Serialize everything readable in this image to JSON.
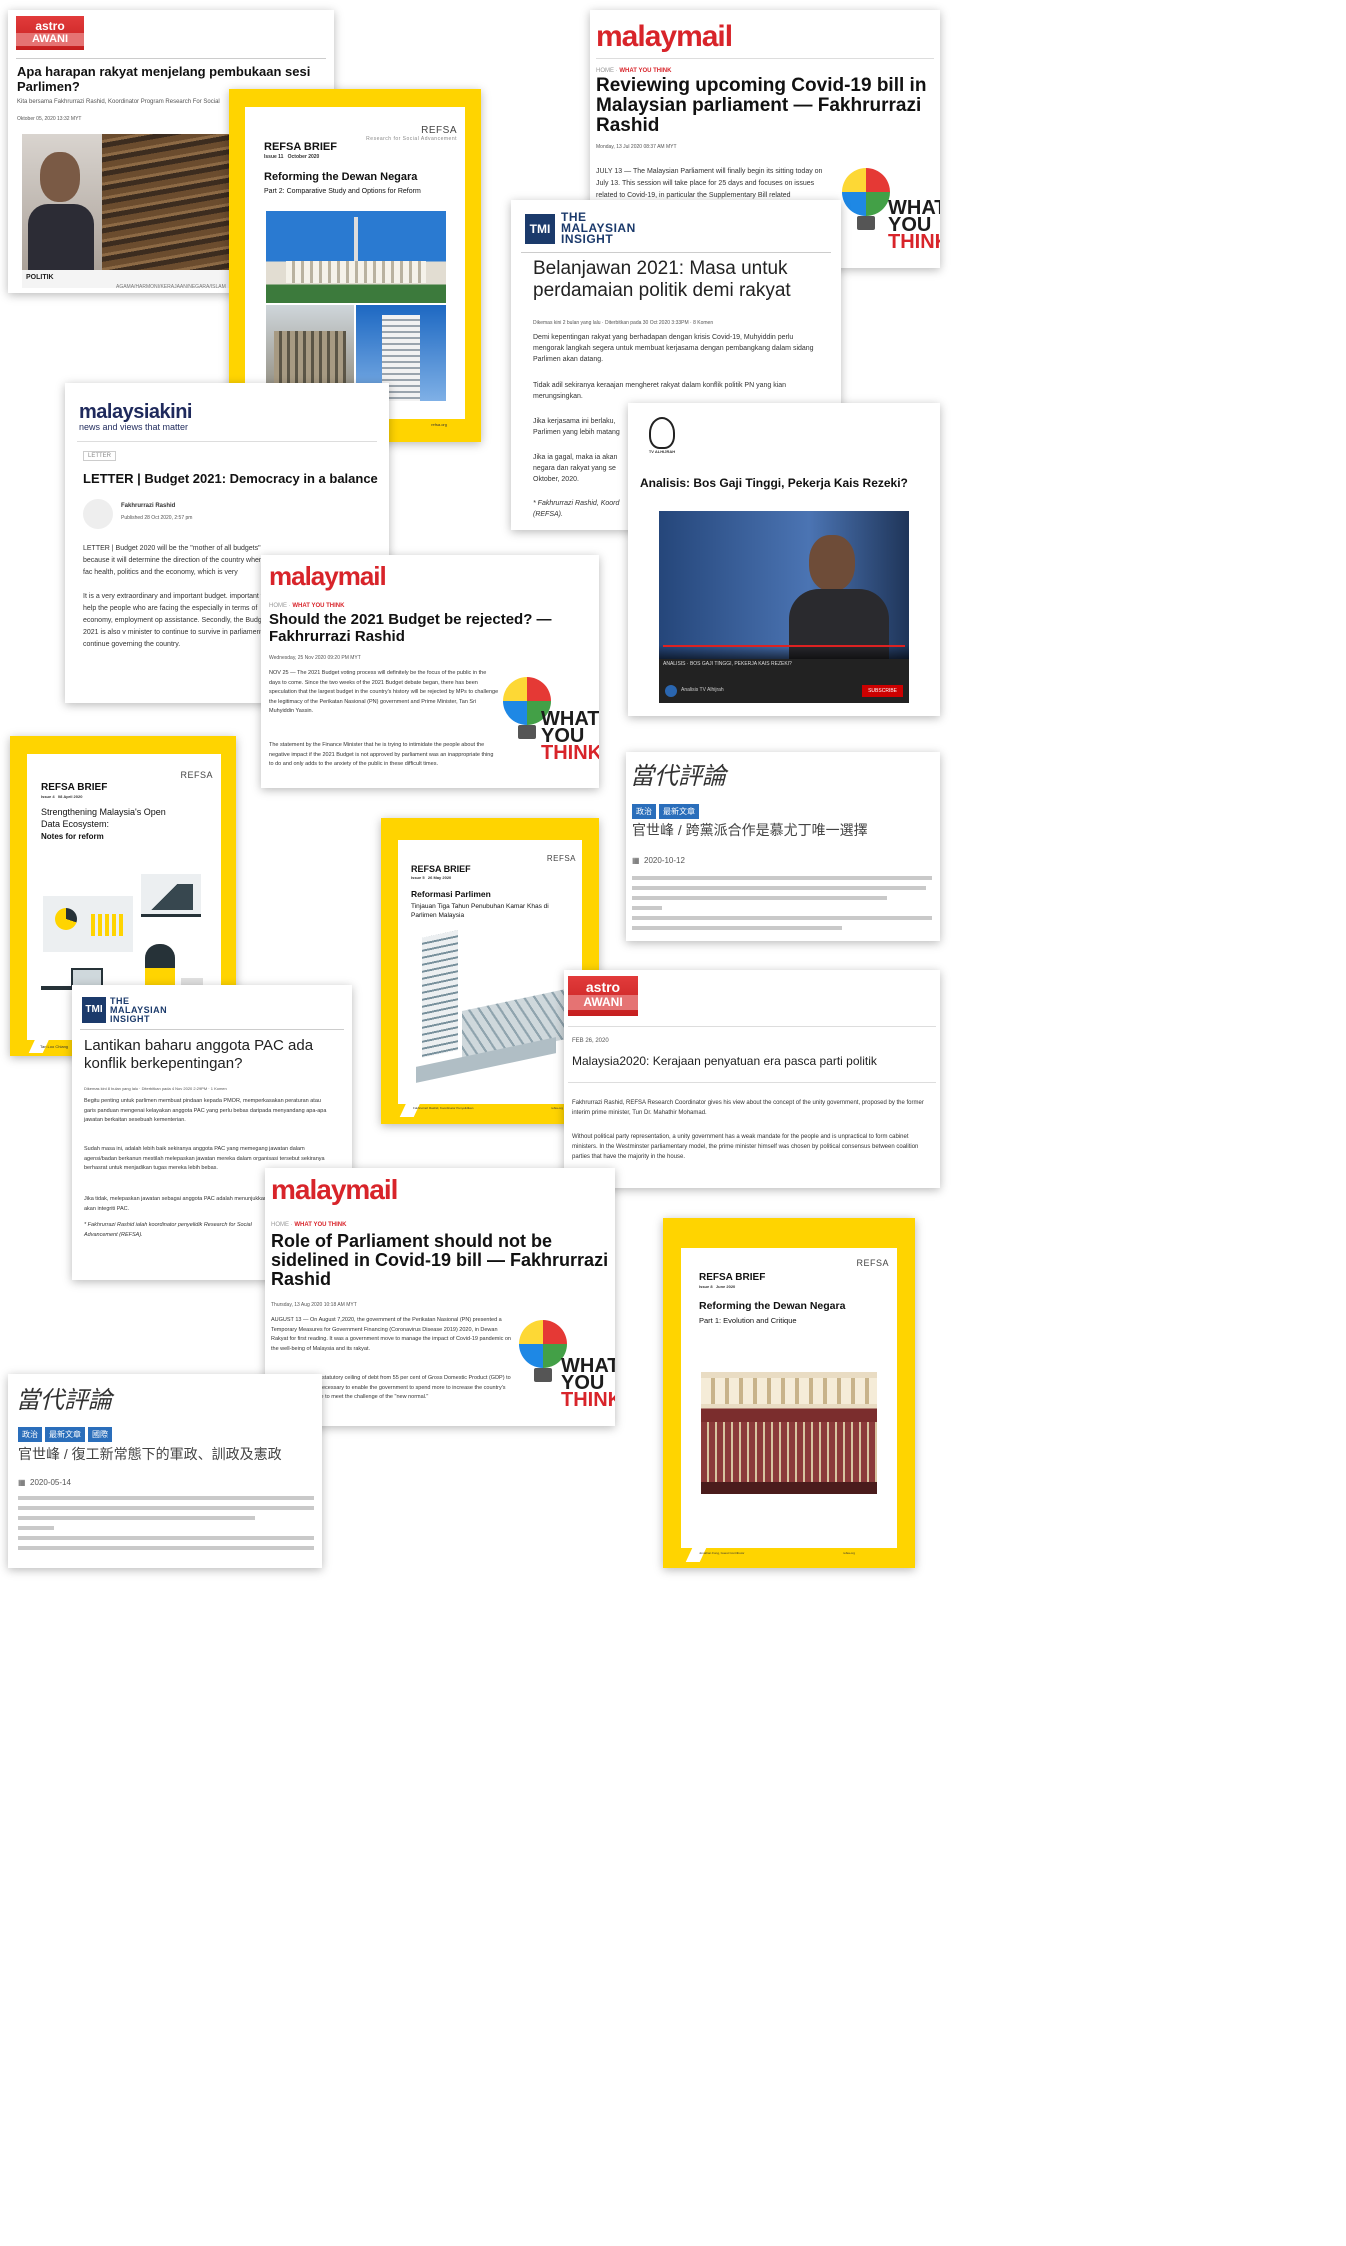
{
  "clips": {
    "astro1": {
      "logo_top": "astro",
      "logo_bottom": "AWANI",
      "headline": "Apa harapan rakyat menjelang pembukaan sesi Parlimen?",
      "byline": "Kita bersama Fakhrurrazi Rashid, Koordinator Program Research For Social",
      "date": "Oktober 05, 2020 13:32 MYT",
      "caption": "POLITIK",
      "ticker": "AGAMA/HARMONI/KERAJAAN/NEGARA/ISLAM"
    },
    "refsa11": {
      "brand": "REFSA BRIEF",
      "issue": "Issue 11",
      "date": "October 2020",
      "logo": "REFSA",
      "logo_sub": "Research for Social Advancement",
      "title": "Reforming the Dewan Negara",
      "subtitle": "Part 2: Comparative Study and Options for Reform",
      "footer_left": "Jonathan Fong, Guest Contributor",
      "footer_right": "refsa.org"
    },
    "malaymail1": {
      "logo": "malaymail",
      "crumb_home": "HOME",
      "crumb_section": "WHAT YOU THINK",
      "headline": "Reviewing upcoming Covid-19 bill in Malaysian parliament — Fakhrurrazi Rashid",
      "date": "Monday, 13 Jul 2020 08:37 AM MYT",
      "body": "JULY 13 — The Malaysian Parliament will finally begin its sitting today on July 13. This session will take place for 25 days and focuses on issues related to Covid-19, in particular the Supplementary Bill related",
      "wyt": [
        "WHAT",
        "YOU",
        "THINK"
      ]
    },
    "tmi1": {
      "logo_mark": "TMI",
      "logo_text": [
        "THE",
        "MALAYSIAN",
        "INSIGHT"
      ],
      "headline": "Belanjawan 2021: Masa untuk perdamaian politik demi rakyat",
      "meta": "Dikemas kini 2 bulan yang lalu · Diterbitkan pada 30 Oct 2020 3:33PM · 8 Komen",
      "p1": "Demi kepentingan rakyat yang berhadapan dengan krisis Covid-19, Muhyiddin perlu mengorak langkah segera untuk membuat kerjasama dengan pembangkang dalam sidang Parlimen akan datang.",
      "p2": "Tidak adil sekiranya keraajan mengheret rakyat dalam konflik politik PN yang kian merungsingkan.",
      "p3": "Jika kerjasama ini berlaku,",
      "p3b": "Parlimen yang lebih matang",
      "p4": "Jika ia gagal, maka ia akan",
      "p4b": "negara dan rakyat yang se",
      "p4c": "Oktober, 2020.",
      "sig": "* Fakhrurrazi Rashid, Koord",
      "sig2": "(REFSA)."
    },
    "mkini": {
      "logo": "malaysiakini",
      "tagline": "news and views that matter",
      "tag": "LETTER",
      "headline": "LETTER | Budget 2021: Democracy in a balance",
      "author": "Fakhrurrazi Rashid",
      "published": "Published 28 Oct 2020, 2:57 pm",
      "p1": "LETTER | Budget 2020 will be the \"mother of all budgets\" because it will determine the direction of the country when fac health, politics and the economy, which is very",
      "p2": "It is a very extraordinary and important budget. important to help the people who are facing the especially in terms of economy, employment op assistance. Secondly, the Budget 2021 is also v minister to continue to survive in parliament to continue governing the country."
    },
    "tvalhijrah": {
      "logo": "TV ALHIJRAH",
      "headline": "Analisis: Bos Gaji Tinggi, Pekerja Kais Rezeki?",
      "video_caption": "ANALISIS · BOS GAJI TINGGI, PEKERJA KAIS REZEKI?",
      "channel": "Analisis TV Alhijrah",
      "subscribe": "SUBSCRIBE"
    },
    "malaymail2": {
      "logo": "malaymail",
      "crumb_home": "HOME",
      "crumb_section": "WHAT YOU THINK",
      "headline": "Should the 2021 Budget be rejected? — Fakhrurrazi Rashid",
      "date": "Wednesday, 25 Nov 2020 09:20 PM MYT",
      "p1": "NOV 25 — The 2021 Budget voting process will definitely be the focus of the public in the days to come. Since the two weeks of the 2021 Budget debate began, there has been speculation that the largest budget in the country's history will be rejected by MPs to challenge the legitimacy of the Perikatan Nasional (PN) government and Prime Minister, Tan Sri Muhyiddin Yassin.",
      "p2": "The statement by the Finance Minister that he is trying to intimidate the people about the negative impact if the 2021 Budget is not approved by parliament was an inappropriate thing to do and only adds to the anxiety of the public in these difficult times.",
      "wyt": [
        "WHAT",
        "YOU",
        "THINK"
      ]
    },
    "refsa4": {
      "brand": "REFSA BRIEF",
      "issue": "Issue 4",
      "date": "08 April 2020",
      "logo": "REFSA",
      "title": "Strengthening Malaysia's Open Data Ecosystem:",
      "subtitle": "Notes for reform",
      "footer_left": "Tan Loo Chiang"
    },
    "cn1": {
      "logo": "當代評論",
      "tags": [
        "政治",
        "最新文章"
      ],
      "headline": "官世峰 / 跨黨派合作是慕尤丁唯一選擇",
      "date": "2020-10-12"
    },
    "refsa5": {
      "brand": "REFSA BRIEF",
      "issue": "Issue 5",
      "date": "26 May 2020",
      "logo": "REFSA",
      "title": "Reformasi Parlimen",
      "subtitle": "Tinjauan Tiga Tahun Penubuhan Kamar Khas di Parlimen Malaysia",
      "footer_left": "Fakhrurrazi Rashid, Koordinator Penyelidikan",
      "footer_right": "refsa.org"
    },
    "tmi2": {
      "logo_mark": "TMI",
      "logo_text": [
        "THE",
        "MALAYSIAN",
        "INSIGHT"
      ],
      "headline": "Lantikan baharu anggota PAC ada konflik berkepentingan?",
      "meta": "Dikemas kini 8 bulan yang lalu · Diterbitkan pada 4 Nov 2020 2:29PM · 1 Komen",
      "p1": "Begitu penting untuk parlimen membuat pindaan kepada PMOR, memperkasakan peraturan atau garis panduan mengenai kelayakan anggota PAC yang perlu bebas daripada menyandang apa-apa jawatan berkaitan sesebuah kementerian.",
      "p2": "Sudah masa ini, adalah lebih baik sekiranya anggota PAC yang memegang jawatan dalam agensi/badan berkanun mestilah melepaskan jawatan mereka dalam organisasi tersebut sekiranya berhasrat untuk menjadikan tugas mereka lebih bebas.",
      "p3": "Jika tidak, melepaskan jawatan sebagai anggota PAC adalah menunjukkan mereka bebas dan peduli akan integriti PAC.",
      "sig": "* Fakhrurrazi Rashid ialah koordinator penyelidik Research for Social Advancement (REFSA)."
    },
    "astro2": {
      "logo_top": "astro",
      "logo_bottom": "AWANI",
      "date": "FEB 26, 2020",
      "headline": "Malaysia2020: Kerajaan penyatuan era pasca parti politik",
      "p1": "Fakhrurrazi Rashid, REFSA Research Coordinator gives his view about the concept of the unity government, proposed by the former interim prime minister, Tun Dr. Mahathir Mohamad.",
      "p2": "Without political party representation, a unity government has a weak mandate for the people and is unpractical to form cabinet ministers. In the Westminster parliamentary model, the prime minister himself was chosen by political consensus between coalition parties that have the majority in the house."
    },
    "malaymail3": {
      "logo": "malaymail",
      "crumb_home": "HOME",
      "crumb_section": "WHAT YOU THINK",
      "headline": "Role of Parliament should not be sidelined in Covid-19 bill — Fakhrurrazi Rashid",
      "date": "Thursday, 13 Aug 2020 10:18 AM MYT",
      "p1": "AUGUST 13 — On August 7,2020, the government of the Perikatan Nasional (PN) presented a Temporary Measures for Government Financing (Coronavirus Disease 2019) 2020, in Dewan Rakyat for first reading. It was a government move to manage the impact of Covid-19 pandemic on the well-being of Malaysia and its rakyat.",
      "p2": "The bill will raise the statutory ceiling of debt from 55 per cent of Gross Domestic Product (GDP) to 60 per cent. This is necessary to enable the government to spend more to increase the country's economic growth rate to meet the challenge of the \"new normal.\"",
      "wyt": [
        "WHAT",
        "YOU",
        "THINK"
      ]
    },
    "refsa8": {
      "brand": "REFSA BRIEF",
      "issue": "Issue 8",
      "date": "June 2020",
      "logo": "REFSA",
      "title": "Reforming the Dewan Negara",
      "subtitle": "Part 1: Evolution and Critique",
      "footer_left": "Jonathan Fong, Guest Contributor",
      "footer_right": "refsa.org"
    },
    "cn2": {
      "logo": "當代評論",
      "tags": [
        "政治",
        "最新文章",
        "國際"
      ],
      "headline": "官世峰 / 復工新常態下的軍政、訓政及憲政",
      "date": "2020-05-14"
    }
  },
  "colors": {
    "refsa_yellow": "#ffd400",
    "malaymail_red": "#d8242a",
    "tmi_navy": "#1b3a6b",
    "astro_red": "#d32f2f",
    "mkini_navy": "#1f2a5c"
  }
}
